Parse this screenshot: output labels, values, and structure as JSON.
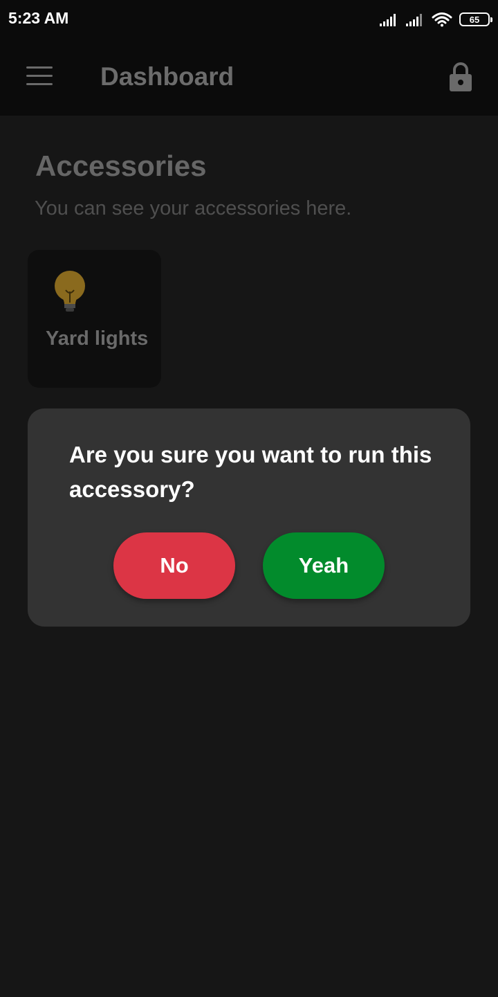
{
  "status_bar": {
    "time": "5:23 AM",
    "battery_level": "65",
    "icons": [
      "signal-icon",
      "signal-icon",
      "wifi-icon",
      "battery-icon"
    ]
  },
  "app_bar": {
    "title": "Dashboard",
    "menu_icon": "menu-icon",
    "lock_icon": "lock-icon"
  },
  "content": {
    "section_title": "Accessories",
    "section_subtitle": "You can see your accessories here.",
    "accessories": [
      {
        "name": "Yard lights",
        "icon": "bulb-icon"
      }
    ]
  },
  "dialog": {
    "message": "Are you sure you want to run this accessory?",
    "no_label": "No",
    "yes_label": "Yeah"
  },
  "colors": {
    "background": "#161616",
    "app_bar": "#0b0b0b",
    "dialog": "#333333",
    "no_button": "#dc3545",
    "yes_button": "#028b2c"
  }
}
